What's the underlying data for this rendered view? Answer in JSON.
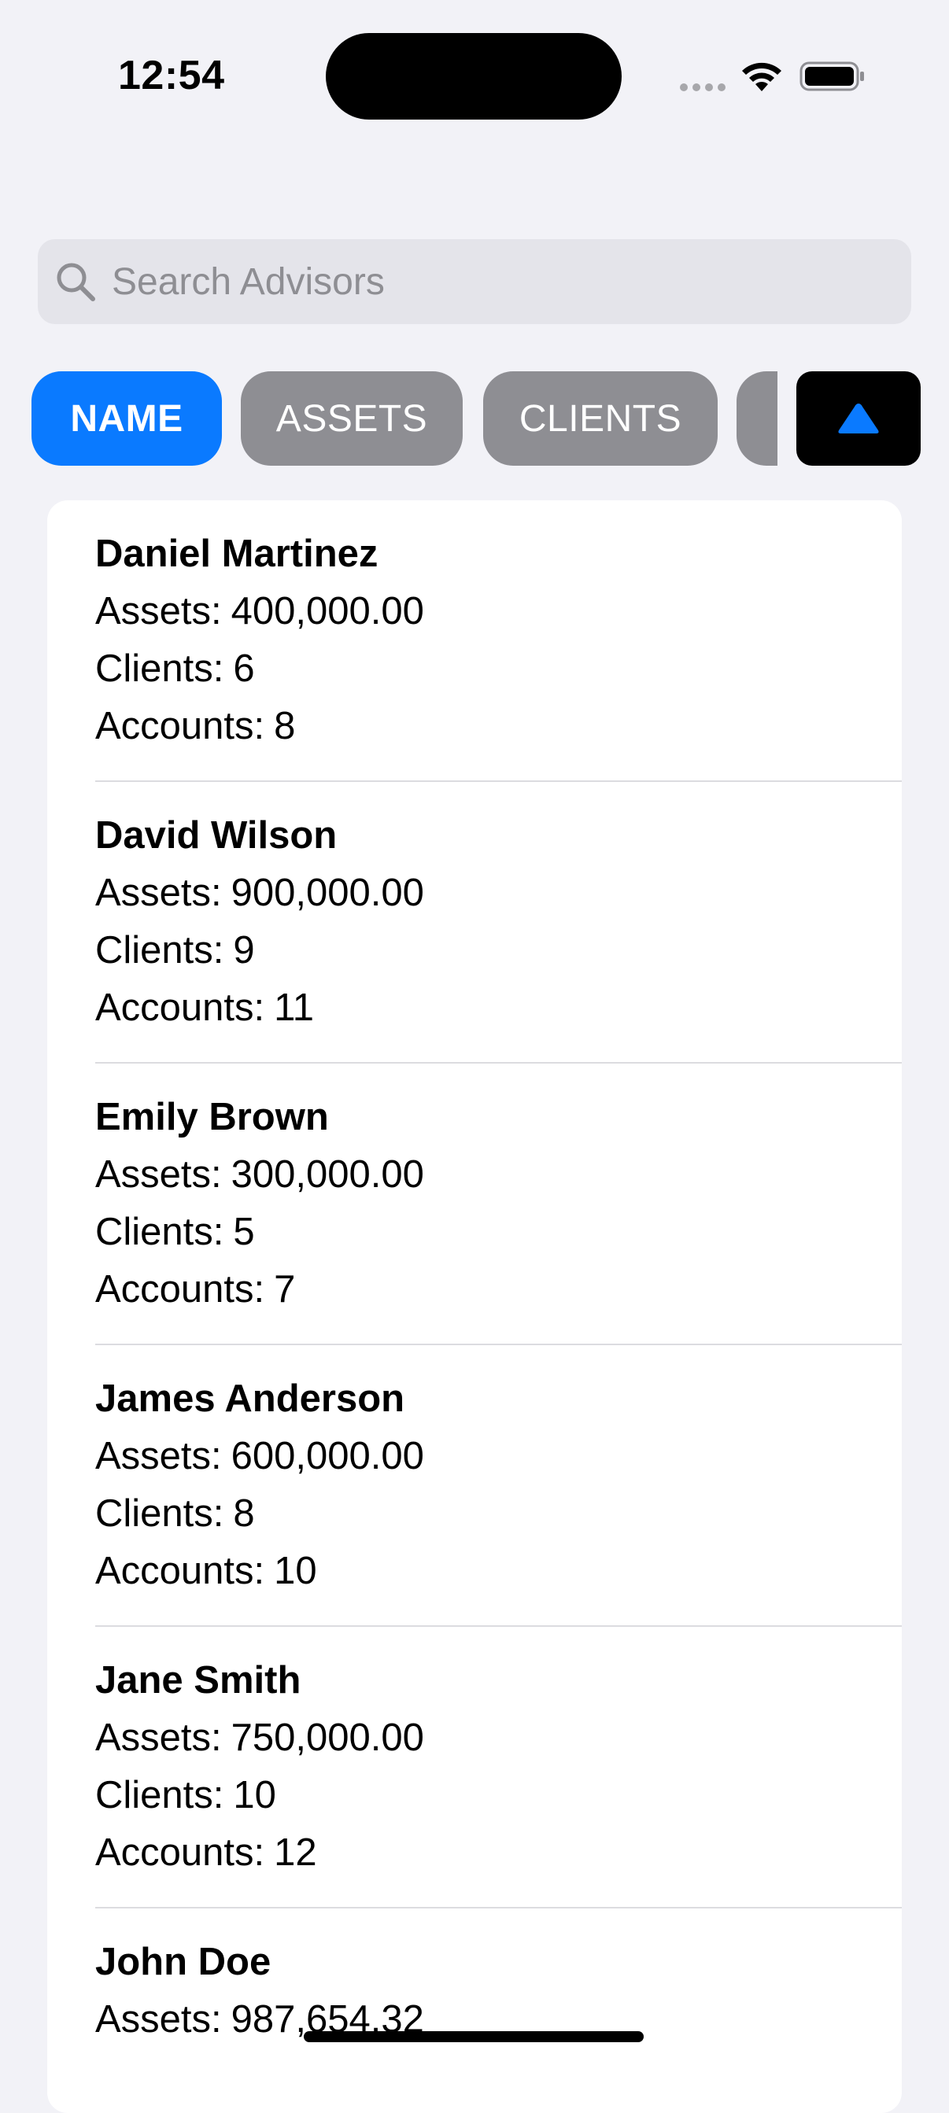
{
  "status_bar": {
    "time": "12:54"
  },
  "search": {
    "placeholder": "Search Advisors",
    "value": "",
    "icon": "magnifying-glass"
  },
  "sort": {
    "options": [
      "NAME",
      "ASSETS",
      "CLIENTS"
    ],
    "selected": "NAME",
    "direction": "ascending",
    "direction_icon": "triangle-up",
    "colors": {
      "selected": "#0a7aff",
      "unselected": "#8e8e93",
      "direction_button": "#000000"
    }
  },
  "labels": {
    "assets": "Assets:",
    "clients": "Clients:",
    "accounts": "Accounts:"
  },
  "advisors": [
    {
      "name": "Daniel Martinez",
      "assets": "400,000.00",
      "clients": "6",
      "accounts": "8"
    },
    {
      "name": "David Wilson",
      "assets": "900,000.00",
      "clients": "9",
      "accounts": "11"
    },
    {
      "name": "Emily Brown",
      "assets": "300,000.00",
      "clients": "5",
      "accounts": "7"
    },
    {
      "name": "James Anderson",
      "assets": "600,000.00",
      "clients": "8",
      "accounts": "10"
    },
    {
      "name": "Jane Smith",
      "assets": "750,000.00",
      "clients": "10",
      "accounts": "12"
    },
    {
      "name": "John Doe",
      "assets": "987,654.32"
    }
  ]
}
